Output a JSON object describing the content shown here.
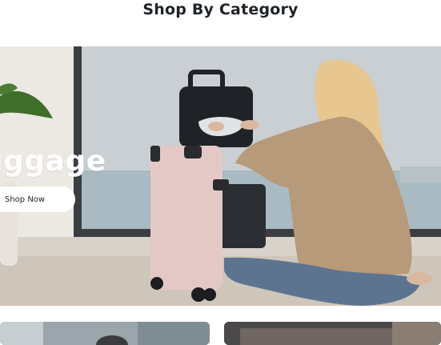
{
  "section": {
    "title": "Shop By Category"
  },
  "hero": {
    "title": "uggage",
    "button_label": "Shop Now",
    "button_icon": "arrow-right-icon"
  },
  "cards": [
    {
      "name": "category-card-left"
    },
    {
      "name": "category-card-right"
    }
  ]
}
